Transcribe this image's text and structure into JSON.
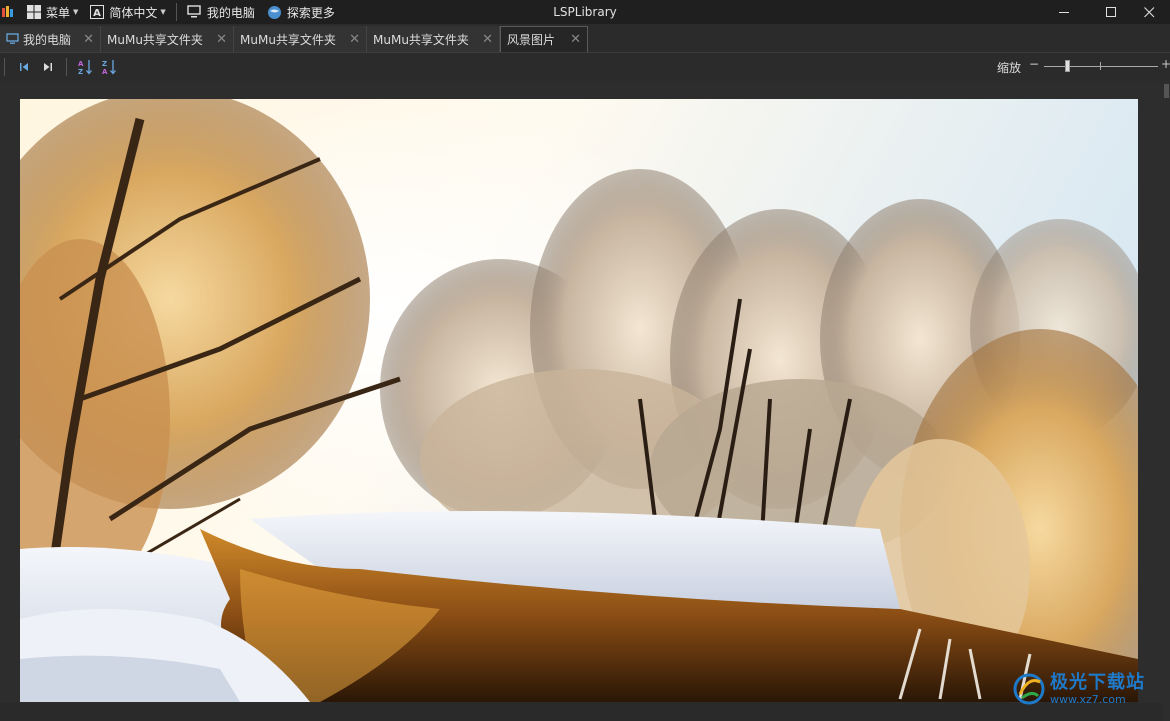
{
  "titlebar": {
    "menu_label": "菜单",
    "language_label": "简体中文",
    "my_computer_label": "我的电脑",
    "explore_label": "探索更多",
    "app_title": "LSPLibrary"
  },
  "tabs": [
    {
      "label": "我的电脑",
      "active": false
    },
    {
      "label": "MuMu共享文件夹",
      "active": false
    },
    {
      "label": "MuMu共享文件夹",
      "active": false
    },
    {
      "label": "MuMu共享文件夹",
      "active": false
    },
    {
      "label": "风景图片",
      "active": true
    }
  ],
  "toolbar": {
    "zoom_label": "缩放",
    "zoom_minus": "−",
    "zoom_plus": "+",
    "zoom_level": 0.2
  },
  "watermark": {
    "title": "极光下载站",
    "url": "www.xz7.com"
  },
  "colors": {
    "accent": "#1e79c9",
    "titlebar_bg": "#1f1f1f",
    "panel_bg": "#2b2b2b"
  }
}
